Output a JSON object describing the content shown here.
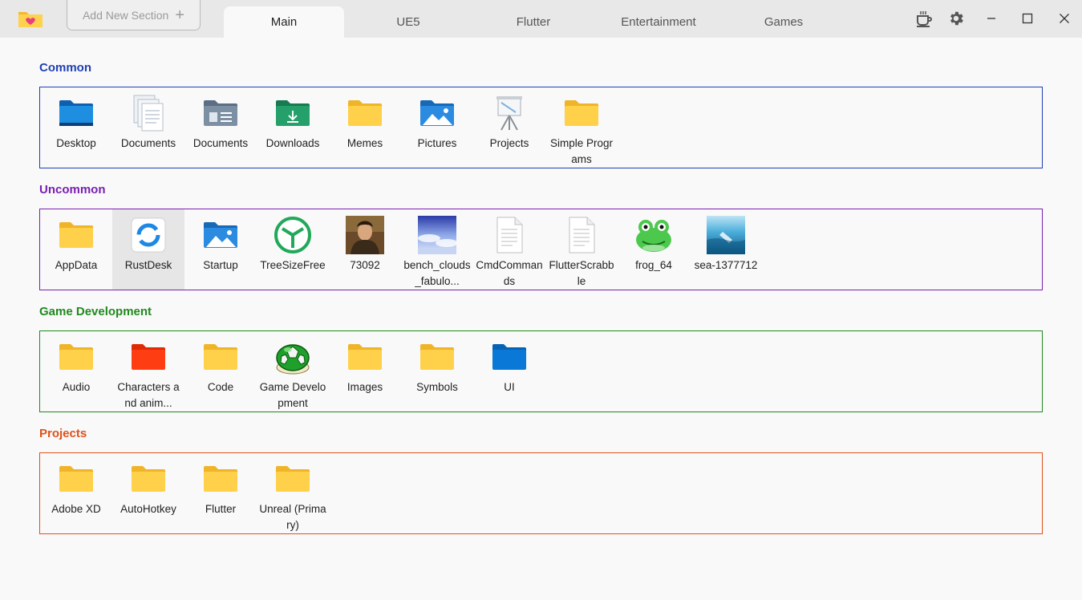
{
  "app": {
    "icon": "folder-heart-icon"
  },
  "toolbar": {
    "add_section_label": "Add New Section"
  },
  "tabs": [
    {
      "label": "Main",
      "active": true
    },
    {
      "label": "UE5"
    },
    {
      "label": "Flutter"
    },
    {
      "label": "Entertainment"
    },
    {
      "label": "Games"
    }
  ],
  "window_controls": [
    "coffee-icon",
    "gear-icon",
    "minimize-icon",
    "maximize-icon",
    "close-icon"
  ],
  "sections": [
    {
      "title": "Common",
      "color": "#1f3fb3",
      "items": [
        {
          "label": "Desktop",
          "icon": "desktop-folder-icon"
        },
        {
          "label": "Documents",
          "icon": "document-file-icon"
        },
        {
          "label": "Documents",
          "icon": "documents-folder-icon"
        },
        {
          "label": "Downloads",
          "icon": "downloads-folder-icon"
        },
        {
          "label": "Memes",
          "icon": "folder-icon"
        },
        {
          "label": "Pictures",
          "icon": "pictures-folder-icon"
        },
        {
          "label": "Projects",
          "icon": "presentation-easel-icon"
        },
        {
          "label": "Simple Programs",
          "icon": "folder-icon"
        }
      ]
    },
    {
      "title": "Uncommon",
      "color": "#7a1fb0",
      "items": [
        {
          "label": "AppData",
          "icon": "folder-icon"
        },
        {
          "label": "RustDesk",
          "icon": "rustdesk-app-icon"
        },
        {
          "label": "Startup",
          "icon": "pictures-folder-icon"
        },
        {
          "label": "TreeSizeFree",
          "icon": "treesize-app-icon"
        },
        {
          "label": "73092",
          "icon": "portrait-image-thumbnail"
        },
        {
          "label": "bench_clouds_fabulo...",
          "icon": "clouds-image-thumbnail"
        },
        {
          "label": "CmdCommands",
          "icon": "text-file-icon"
        },
        {
          "label": "FlutterScrabble",
          "icon": "text-file-icon"
        },
        {
          "label": "frog_64",
          "icon": "frog-image-icon"
        },
        {
          "label": "sea-1377712",
          "icon": "sea-image-thumbnail"
        }
      ]
    },
    {
      "title": "Game Development",
      "color": "#1f8a1f",
      "items": [
        {
          "label": "Audio",
          "icon": "folder-icon"
        },
        {
          "label": "Characters and anim...",
          "icon": "red-folder-icon"
        },
        {
          "label": "Code",
          "icon": "folder-icon"
        },
        {
          "label": "Game Development",
          "icon": "green-shell-icon"
        },
        {
          "label": "Images",
          "icon": "folder-icon"
        },
        {
          "label": "Symbols",
          "icon": "folder-icon"
        },
        {
          "label": "UI",
          "icon": "blue-folder-icon"
        }
      ]
    },
    {
      "title": "Projects",
      "color": "#e0501a",
      "items": [
        {
          "label": "Adobe XD",
          "icon": "folder-icon"
        },
        {
          "label": "AutoHotkey",
          "icon": "folder-icon"
        },
        {
          "label": "Flutter",
          "icon": "folder-icon"
        },
        {
          "label": "Unreal (Primary)",
          "icon": "folder-icon"
        }
      ]
    }
  ]
}
